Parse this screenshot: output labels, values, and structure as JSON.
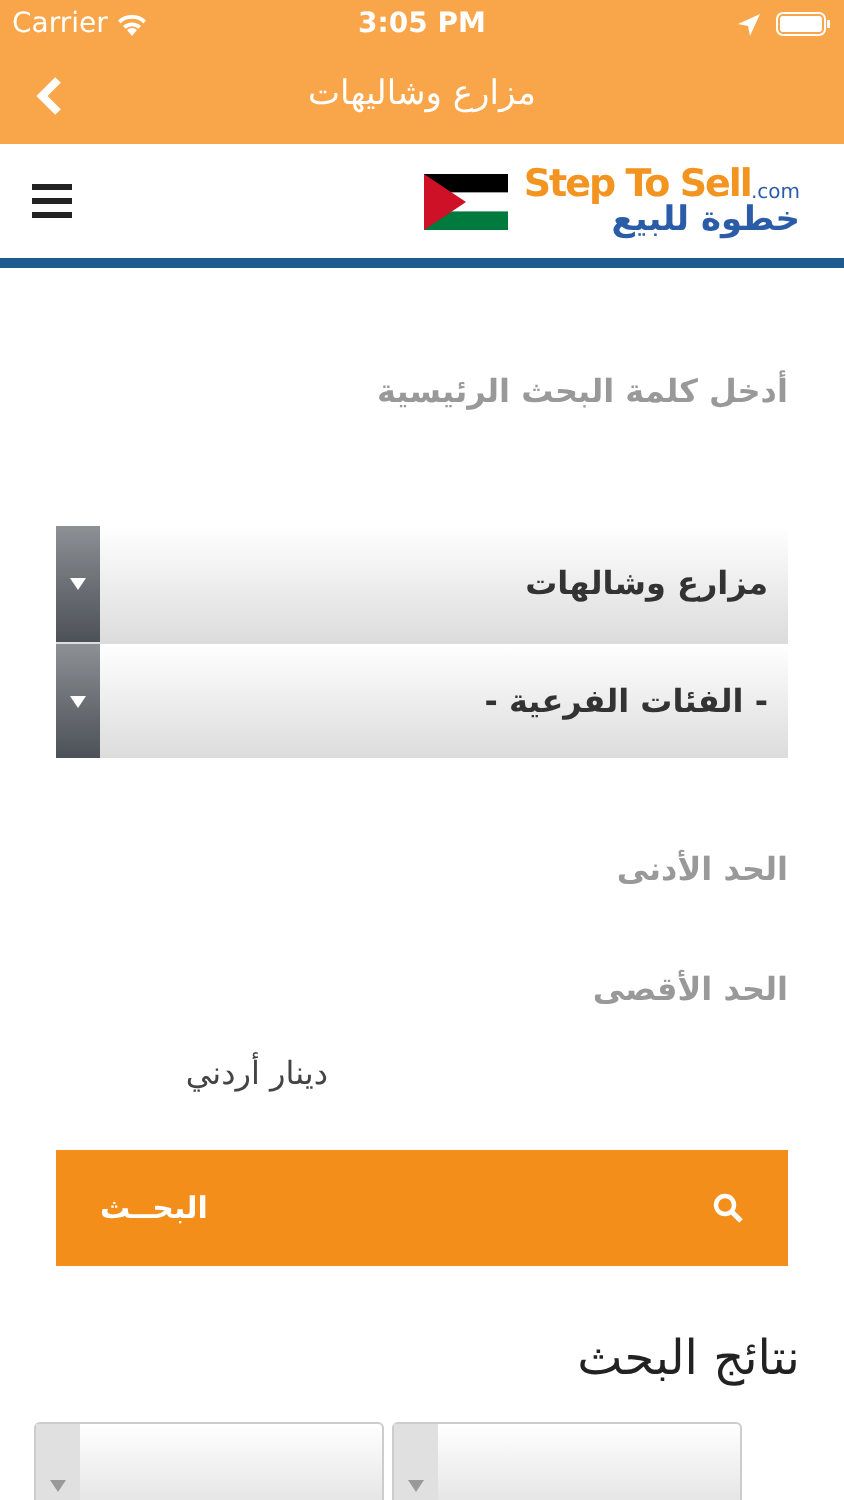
{
  "status_bar": {
    "carrier": "Carrier",
    "time": "3:05 PM"
  },
  "nav_bar": {
    "title": "مزارع وشاليهات"
  },
  "header": {
    "logo_latin": "Step To Sell",
    "logo_domain": ".com",
    "logo_arabic": "خطوة للبيع"
  },
  "keyword_field": {
    "placeholder": "أدخل كلمة البحث الرئيسية"
  },
  "dropdowns": [
    {
      "value": "مزارع وشالهات"
    },
    {
      "value": "- الفئات الفرعية -"
    }
  ],
  "min_price": {
    "placeholder": "الحد الأدنى"
  },
  "max_price": {
    "placeholder": "الحد الأقصى"
  },
  "currency": "دينار أردني",
  "search_button": {
    "label": "البحــث"
  },
  "results": {
    "title": "نتائج البحث",
    "sort_dropdowns": [
      {
        "kind": "dropdown"
      },
      {
        "kind": "dropdown"
      }
    ]
  }
}
